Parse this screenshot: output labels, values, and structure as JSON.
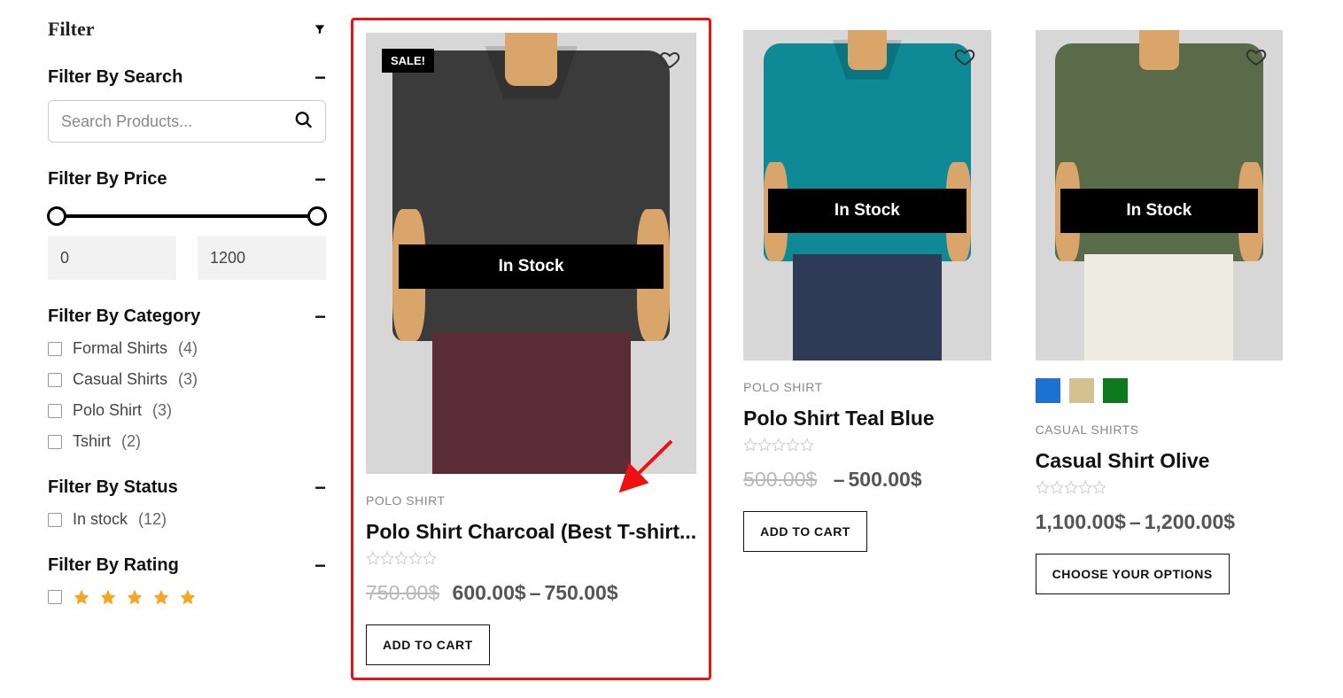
{
  "filter": {
    "title": "Filter",
    "search": {
      "heading": "Filter By Search",
      "placeholder": "Search Products..."
    },
    "price": {
      "heading": "Filter By Price",
      "min": "0",
      "max": "1200"
    },
    "category": {
      "heading": "Filter By Category",
      "items": [
        {
          "label": "Formal Shirts",
          "count": "(4)"
        },
        {
          "label": "Casual Shirts",
          "count": "(3)"
        },
        {
          "label": "Polo Shirt",
          "count": "(3)"
        },
        {
          "label": "Tshirt",
          "count": "(2)"
        }
      ]
    },
    "status": {
      "heading": "Filter By Status",
      "items": [
        {
          "label": "In stock",
          "count": "(12)"
        }
      ]
    },
    "rating": {
      "heading": "Filter By Rating"
    }
  },
  "products": [
    {
      "badge": "SALE!",
      "stock": "In Stock",
      "category": "POLO SHIRT",
      "name": "Polo Shirt Charcoal (Best T-shirt...",
      "old_price": "750.00$",
      "price_from": "600.00$",
      "price_to": "750.00$",
      "button": "ADD TO CART"
    },
    {
      "stock": "In Stock",
      "category": "POLO SHIRT",
      "name": "Polo Shirt Teal Blue",
      "old_price": "500.00$",
      "price_from": "500.00$",
      "button": "ADD TO CART"
    },
    {
      "stock": "In Stock",
      "category": "CASUAL SHIRTS",
      "name": "Casual Shirt Olive",
      "price_from": "1,100.00$",
      "price_to": "1,200.00$",
      "button": "CHOOSE YOUR OPTIONS"
    }
  ]
}
